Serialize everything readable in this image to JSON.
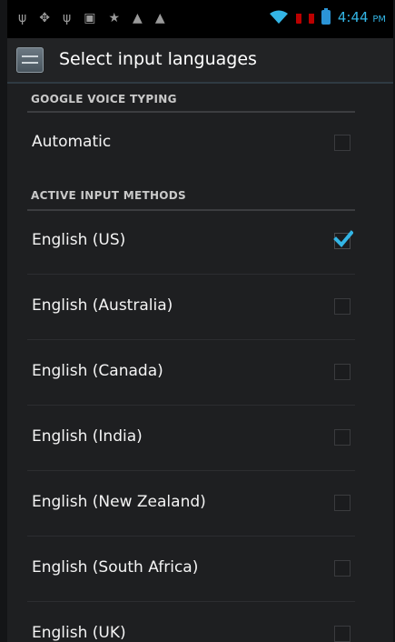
{
  "status_bar": {
    "icons": [
      "usb-icon",
      "debug-icon",
      "usb-icon",
      "picture-icon",
      "star-icon",
      "warning-icon",
      "warning-icon"
    ],
    "time": "4:44",
    "ampm": "PM",
    "accent_color": "#33b5e5"
  },
  "action_bar": {
    "title": "Select input languages"
  },
  "sections": {
    "voice": {
      "header": "GOOGLE VOICE TYPING"
    },
    "active": {
      "header": "ACTIVE INPUT METHODS"
    }
  },
  "items": [
    {
      "label": "Automatic",
      "checked": false
    },
    {
      "label": "English (US)",
      "checked": true
    },
    {
      "label": "English (Australia)",
      "checked": false
    },
    {
      "label": "English (Canada)",
      "checked": false
    },
    {
      "label": "English (India)",
      "checked": false
    },
    {
      "label": "English (New Zealand)",
      "checked": false
    },
    {
      "label": "English (South Africa)",
      "checked": false
    },
    {
      "label": "English (UK)",
      "checked": false
    }
  ]
}
